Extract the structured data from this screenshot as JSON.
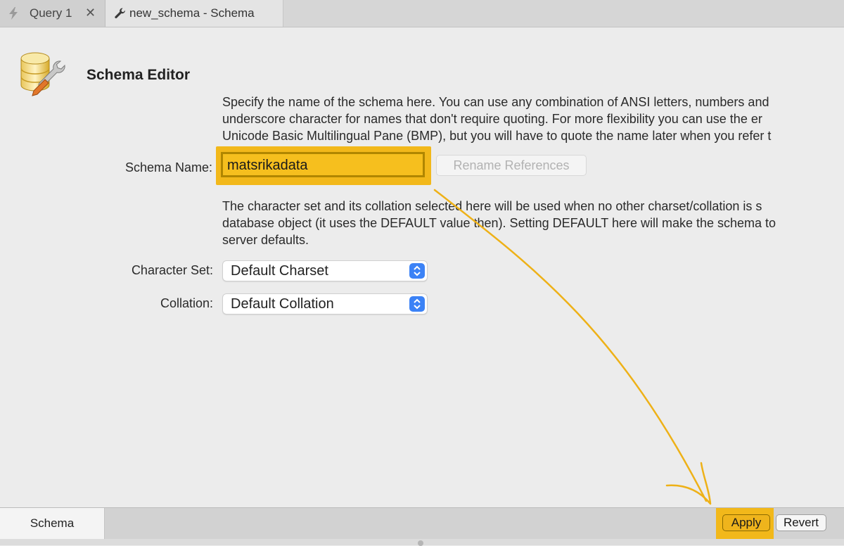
{
  "tabs": [
    {
      "label": "Query 1",
      "icon": "lightning-bolt-icon",
      "closable": true
    },
    {
      "label": "new_schema - Schema",
      "icon": "wrench-icon",
      "active": true
    }
  ],
  "editor": {
    "title": "Schema Editor",
    "name_description": [
      "Specify the name of the schema here. You can use any combination of ANSI letters, numbers and",
      "underscore character for names that don't require quoting. For more flexibility you can use the er",
      "Unicode Basic Multilingual Pane (BMP), but you will have to quote the name later when you refer t"
    ],
    "name_label": "Schema Name:",
    "name_value": "matsrikadata",
    "rename_button": "Rename References",
    "charset_description": [
      "The character set and its collation selected here will be used when no other charset/collation is s",
      "database object (it uses the DEFAULT value then). Setting DEFAULT here will make the schema to",
      "server defaults."
    ],
    "charset_label": "Character Set:",
    "charset_value": "Default Charset",
    "collation_label": "Collation:",
    "collation_value": "Default Collation"
  },
  "bottom": {
    "tab_label": "Schema",
    "apply_label": "Apply",
    "revert_label": "Revert"
  },
  "colors": {
    "highlight": "#f2b81a",
    "select_stepper": "#3b82f6",
    "arrow": "#eeb117"
  }
}
